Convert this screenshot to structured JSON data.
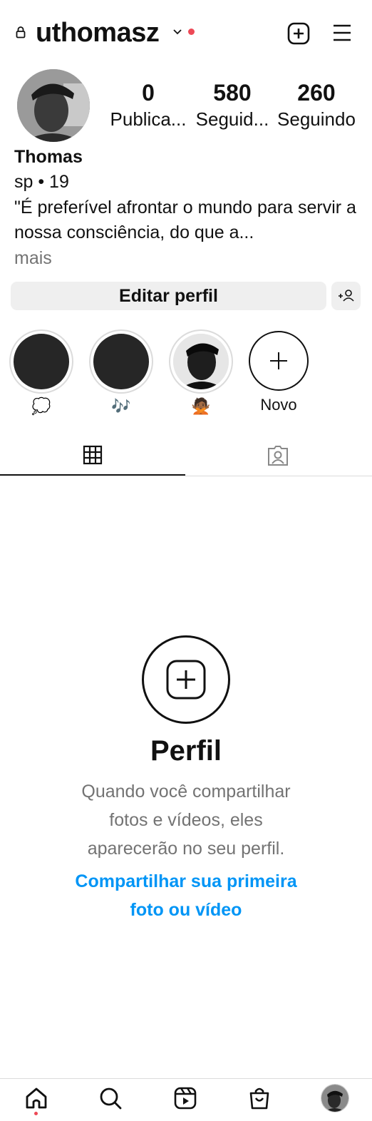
{
  "header": {
    "username": "uthomasz",
    "icons": [
      "lock-icon",
      "chevron-down-icon",
      "notification-dot",
      "new-post-icon",
      "menu-icon"
    ]
  },
  "profile": {
    "stats": [
      {
        "value": "0",
        "label": "Publica..."
      },
      {
        "value": "580",
        "label": "Seguid..."
      },
      {
        "value": "260",
        "label": "Seguindo"
      }
    ],
    "name": "Thomas",
    "subtitle": "sp • 19",
    "bio": "\"É preferível afrontar o mundo para servir a nossa consciência, do que a...",
    "more": "mais"
  },
  "actions": {
    "edit_profile": "Editar perfil"
  },
  "highlights": [
    {
      "label": "💭"
    },
    {
      "label": "🎶"
    },
    {
      "label": "🙅🏾"
    },
    {
      "label": "Novo"
    }
  ],
  "tabs": [
    "grid-icon",
    "tagged-icon"
  ],
  "empty_state": {
    "title": "Perfil",
    "text": "Quando você compartilhar fotos e vídeos, eles aparecerão no seu perfil.",
    "link": "Compartilhar sua primeira foto ou vídeo"
  },
  "bottom_nav": [
    "home-icon",
    "search-icon",
    "reels-icon",
    "shop-icon",
    "profile-avatar"
  ],
  "colors": {
    "accent_link": "#0095f6",
    "notification": "#ed4956",
    "button_bg": "#efefef",
    "muted_text": "#737373"
  }
}
